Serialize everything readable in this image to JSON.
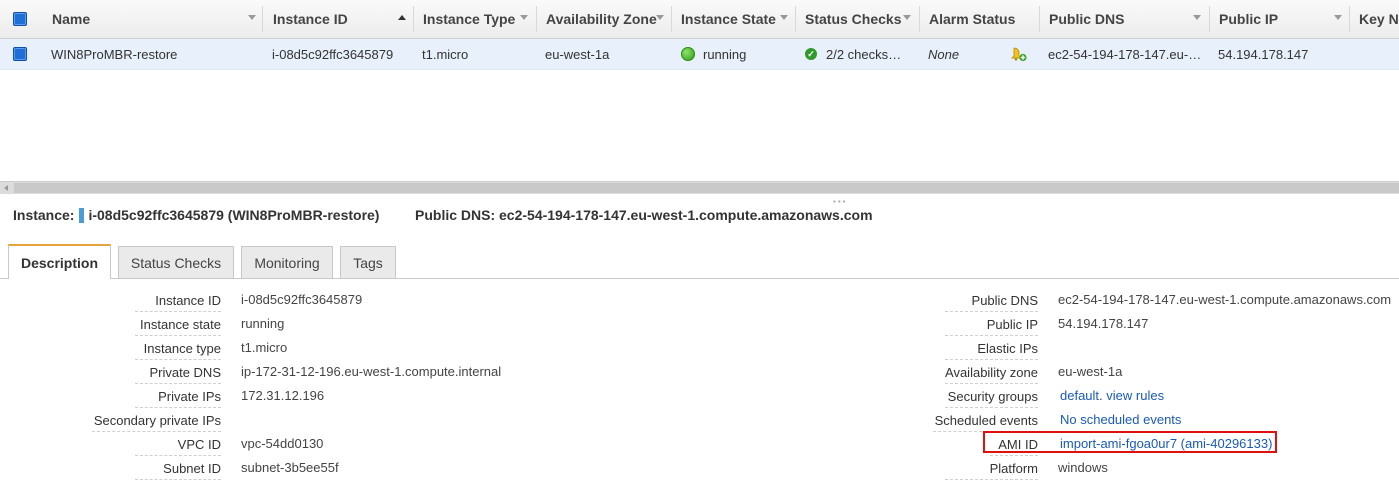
{
  "table": {
    "columns": [
      {
        "label": "Name"
      },
      {
        "label": "Instance ID"
      },
      {
        "label": "Instance Type"
      },
      {
        "label": "Availability Zone"
      },
      {
        "label": "Instance State"
      },
      {
        "label": "Status Checks"
      },
      {
        "label": "Alarm Status"
      },
      {
        "label": "Public DNS"
      },
      {
        "label": "Public IP"
      },
      {
        "label": "Key Na"
      }
    ],
    "rows": [
      {
        "name": "WIN8ProMBR-restore",
        "instance_id": "i-08d5c92ffc3645879",
        "instance_type": "t1.micro",
        "availability_zone": "eu-west-1a",
        "instance_state": "running",
        "status_checks": "2/2 checks…",
        "alarm_status": "None",
        "public_dns": "ec2-54-194-178-147.eu-…",
        "public_ip": "54.194.178.147"
      }
    ]
  },
  "details": {
    "instance_label": "Instance:",
    "instance_value": "i-08d5c92ffc3645879 (WIN8ProMBR-restore)",
    "public_dns_label": "Public DNS:",
    "public_dns_value": "ec2-54-194-178-147.eu-west-1.compute.amazonaws.com",
    "tabs": [
      {
        "label": "Description"
      },
      {
        "label": "Status Checks"
      },
      {
        "label": "Monitoring"
      },
      {
        "label": "Tags"
      }
    ],
    "left_fields": [
      {
        "label": "Instance ID",
        "value": "i-08d5c92ffc3645879"
      },
      {
        "label": "Instance state",
        "value": "running"
      },
      {
        "label": "Instance type",
        "value": "t1.micro"
      },
      {
        "label": "Private DNS",
        "value": "ip-172-31-12-196.eu-west-1.compute.internal"
      },
      {
        "label": "Private IPs",
        "value": "172.31.12.196"
      },
      {
        "label": "Secondary private IPs",
        "value": ""
      },
      {
        "label": "VPC ID",
        "value": "vpc-54dd0130"
      },
      {
        "label": "Subnet ID",
        "value": "subnet-3b5ee55f"
      }
    ],
    "right_fields": [
      {
        "label": "Public DNS",
        "value": "ec2-54-194-178-147.eu-west-1.compute.amazonaws.com"
      },
      {
        "label": "Public IP",
        "value": "54.194.178.147"
      },
      {
        "label": "Elastic IPs",
        "value": ""
      },
      {
        "label": "Availability zone",
        "value": "eu-west-1a"
      },
      {
        "label": "Security groups",
        "link1": "default",
        "sep": ".",
        "link2": "view rules"
      },
      {
        "label": "Scheduled events",
        "link1": "No scheduled events"
      },
      {
        "label": "AMI ID",
        "link1": "import-ami-fgoa0ur7 (ami-40296133)"
      },
      {
        "label": "Platform",
        "value": "windows"
      }
    ]
  },
  "colors": {
    "accent_tab": "#e6a43c",
    "link": "#1a5ab8",
    "selected_row": "#e8f0fb",
    "highlight_box": "#e01010",
    "running_green": "#2e9b12"
  },
  "icons": {
    "header_checkbox": "checkbox-checked-icon",
    "row_checkbox": "checkbox-checked-icon",
    "state": "running-status-icon",
    "checks": "check-passed-icon",
    "alarm": "create-alarm-icon"
  }
}
